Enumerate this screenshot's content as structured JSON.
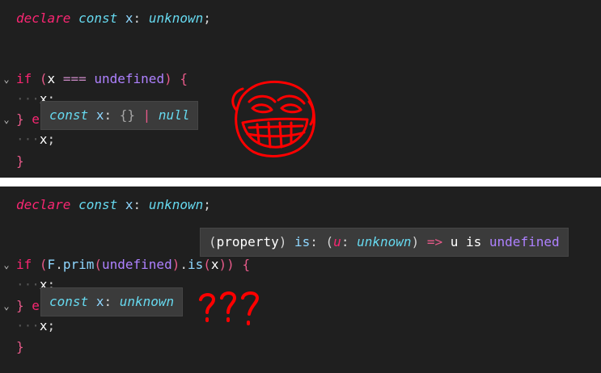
{
  "top": {
    "declare_kw": "declare",
    "const_kw": "const",
    "decl_var": "x",
    "decl_colon": ":",
    "decl_type": "unknown",
    "decl_semi": ";",
    "if_kw": "if",
    "paren_open": "(",
    "cond_var": "x",
    "cond_op": "===",
    "cond_value": "undefined",
    "paren_close": ")",
    "brace_open": "{",
    "body1_ws": "···",
    "body1_var": "x",
    "body1_semi": ";",
    "else_brace": "}",
    "else_partial": "e",
    "body2_ws": "···",
    "body2_var": "x",
    "body2_semi": ";",
    "brace_close": "}",
    "tooltip": {
      "const": "const",
      "var": "x",
      "colon": ":",
      "type_obj": "{}",
      "pipe": "|",
      "type_null": "null"
    }
  },
  "bottom": {
    "declare_kw": "declare",
    "const_kw": "const",
    "decl_var": "x",
    "decl_colon": ":",
    "decl_type": "unknown",
    "decl_semi": ";",
    "if_kw": "if",
    "paren_open": "(",
    "call_obj": "F",
    "call_dot": ".",
    "call_method": "prim",
    "call_paren_open": "(",
    "call_arg": "undefined",
    "call_paren_close": ")",
    "is_dot": ".",
    "is_method": "is",
    "is_paren_open": "(",
    "is_arg": "x",
    "is_paren_close": ")",
    "paren_close": ")",
    "brace_open": "{",
    "body1_ws": "···",
    "body1_var": "x",
    "body1_semi": ";",
    "else_brace": "}",
    "else_partial": "e",
    "body2_ws": "···",
    "body2_var": "x",
    "body2_semi": ";",
    "brace_close": "}",
    "tooltip_property": {
      "paren_open": "(",
      "kind": "property",
      "paren_close": ")",
      "name": "is",
      "colon": ":",
      "sig_open": "(",
      "param": "u",
      "param_colon": ":",
      "param_type": "unknown",
      "sig_close": ")",
      "arrow": "=>",
      "pred_var": "u",
      "pred_is": "is",
      "pred_type": "undefined"
    },
    "tooltip_const": {
      "const": "const",
      "var": "x",
      "colon": ":",
      "type": "unknown"
    },
    "annotation": "???"
  },
  "icons": {
    "fold": "chevron-down-icon",
    "drawing": "troll-face-icon"
  },
  "colors": {
    "editor_bg": "#1f1f1f",
    "divider": "#ffffff",
    "scribble": "#ff0000"
  }
}
